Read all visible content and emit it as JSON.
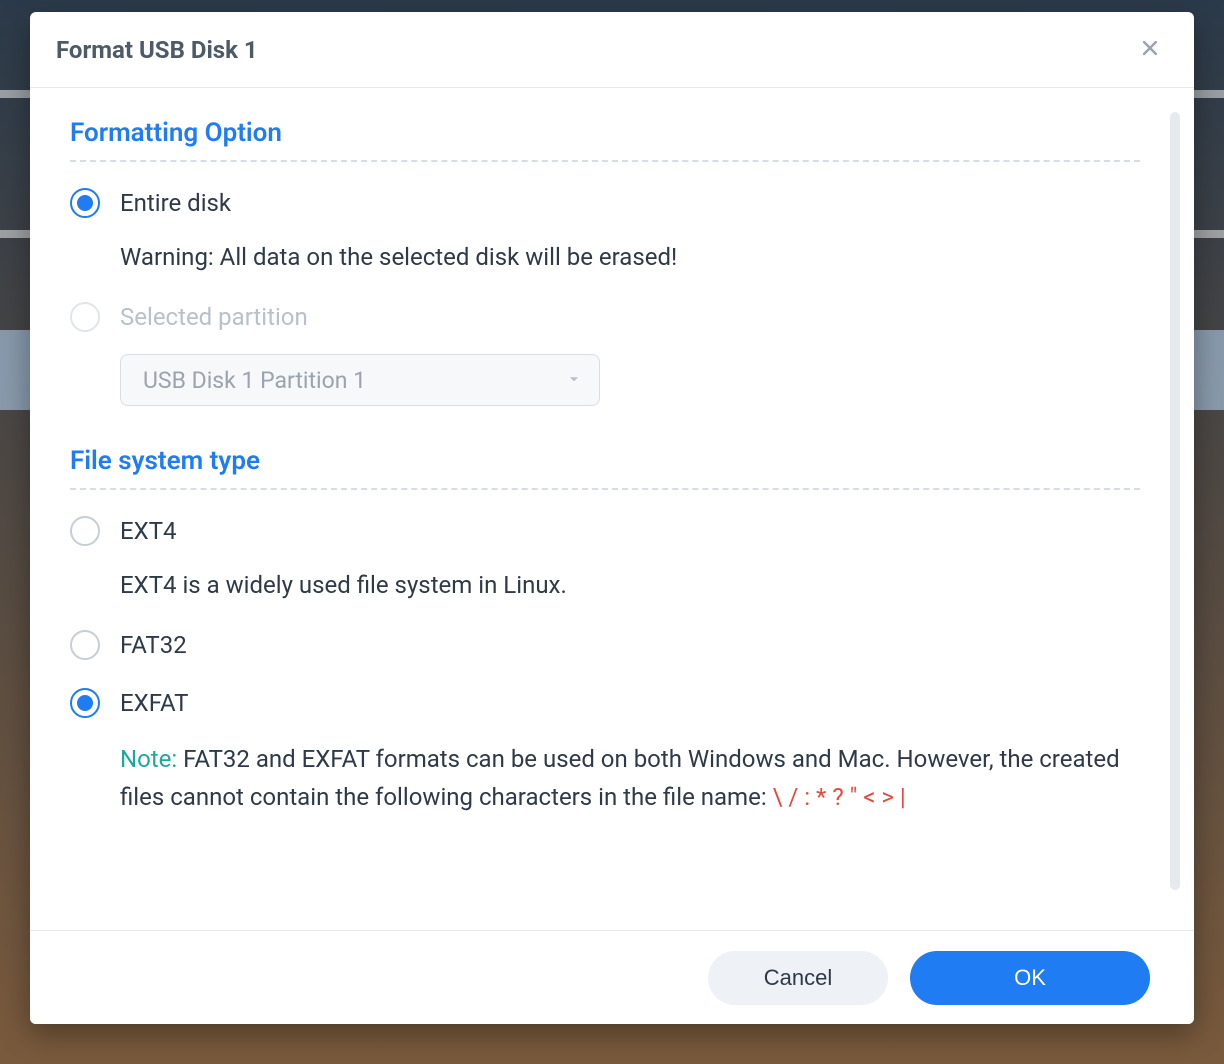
{
  "dialog": {
    "title": "Format USB Disk 1"
  },
  "formatting": {
    "section_title": "Formatting Option",
    "entire_disk_label": "Entire disk",
    "entire_disk_warning": "Warning: All data on the selected disk will be erased!",
    "selected_partition_label": "Selected partition",
    "partition_dropdown_value": "USB Disk 1 Partition 1"
  },
  "filesystem": {
    "section_title": "File system type",
    "ext4_label": "EXT4",
    "ext4_desc": "EXT4 is a widely used file system in Linux.",
    "fat32_label": "FAT32",
    "exfat_label": "EXFAT",
    "note_label": "Note:",
    "note_body": " FAT32 and EXFAT formats can be used on both Windows and Mac. However, the created files cannot contain the following characters in the file name: ",
    "note_chars": "\\ / : * ? \" < > |"
  },
  "footer": {
    "cancel": "Cancel",
    "ok": "OK"
  }
}
